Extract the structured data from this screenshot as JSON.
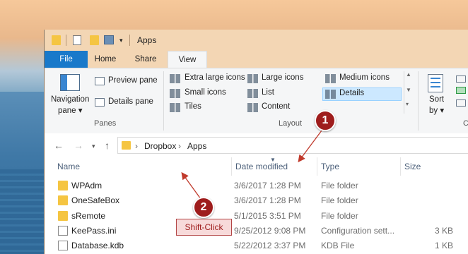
{
  "window": {
    "title": "Apps"
  },
  "tabs": {
    "file": "File",
    "home": "Home",
    "share": "Share",
    "view": "View"
  },
  "ribbon": {
    "navigation_pane": "Navigation",
    "navigation_pane2": "pane",
    "preview_pane": "Preview pane",
    "details_pane": "Details pane",
    "panes_group": "Panes",
    "layout_group": "Layout",
    "layout_items": {
      "extra_large": "Extra large icons",
      "large": "Large icons",
      "medium": "Medium icons",
      "small": "Small icons",
      "list": "List",
      "details": "Details",
      "tiles": "Tiles",
      "content": "Content"
    },
    "sort_by": "Sort",
    "sort_by2": "by",
    "current_group": "C"
  },
  "address": {
    "crumbs": [
      "Dropbox",
      "Apps"
    ]
  },
  "columns": {
    "name": "Name",
    "date": "Date modified",
    "type": "Type",
    "size": "Size"
  },
  "files": [
    {
      "name": "WPAdm",
      "date": "3/6/2017 1:28 PM",
      "type": "File folder",
      "size": "",
      "icon": "folder-user-icon"
    },
    {
      "name": "OneSafeBox",
      "date": "3/6/2017 1:28 PM",
      "type": "File folder",
      "size": "",
      "icon": "folder-user-icon"
    },
    {
      "name": "sRemote",
      "date": "5/1/2015 3:51 PM",
      "type": "File folder",
      "size": "",
      "icon": "folder-icon"
    },
    {
      "name": "KeePass.ini",
      "date": "9/25/2012 9:08 PM",
      "type": "Configuration sett...",
      "size": "3 KB",
      "icon": "ini-file-icon"
    },
    {
      "name": "Database.kdb",
      "date": "5/22/2012 3:37 PM",
      "type": "KDB File",
      "size": "1 KB",
      "icon": "file-icon"
    }
  ],
  "annotations": {
    "badge1": "1",
    "badge2": "2",
    "shift_click": "Shift-Click"
  },
  "colors": {
    "accent": "#1979ca",
    "annotation": "#9e1c1c",
    "selected": "#cce8ff"
  }
}
